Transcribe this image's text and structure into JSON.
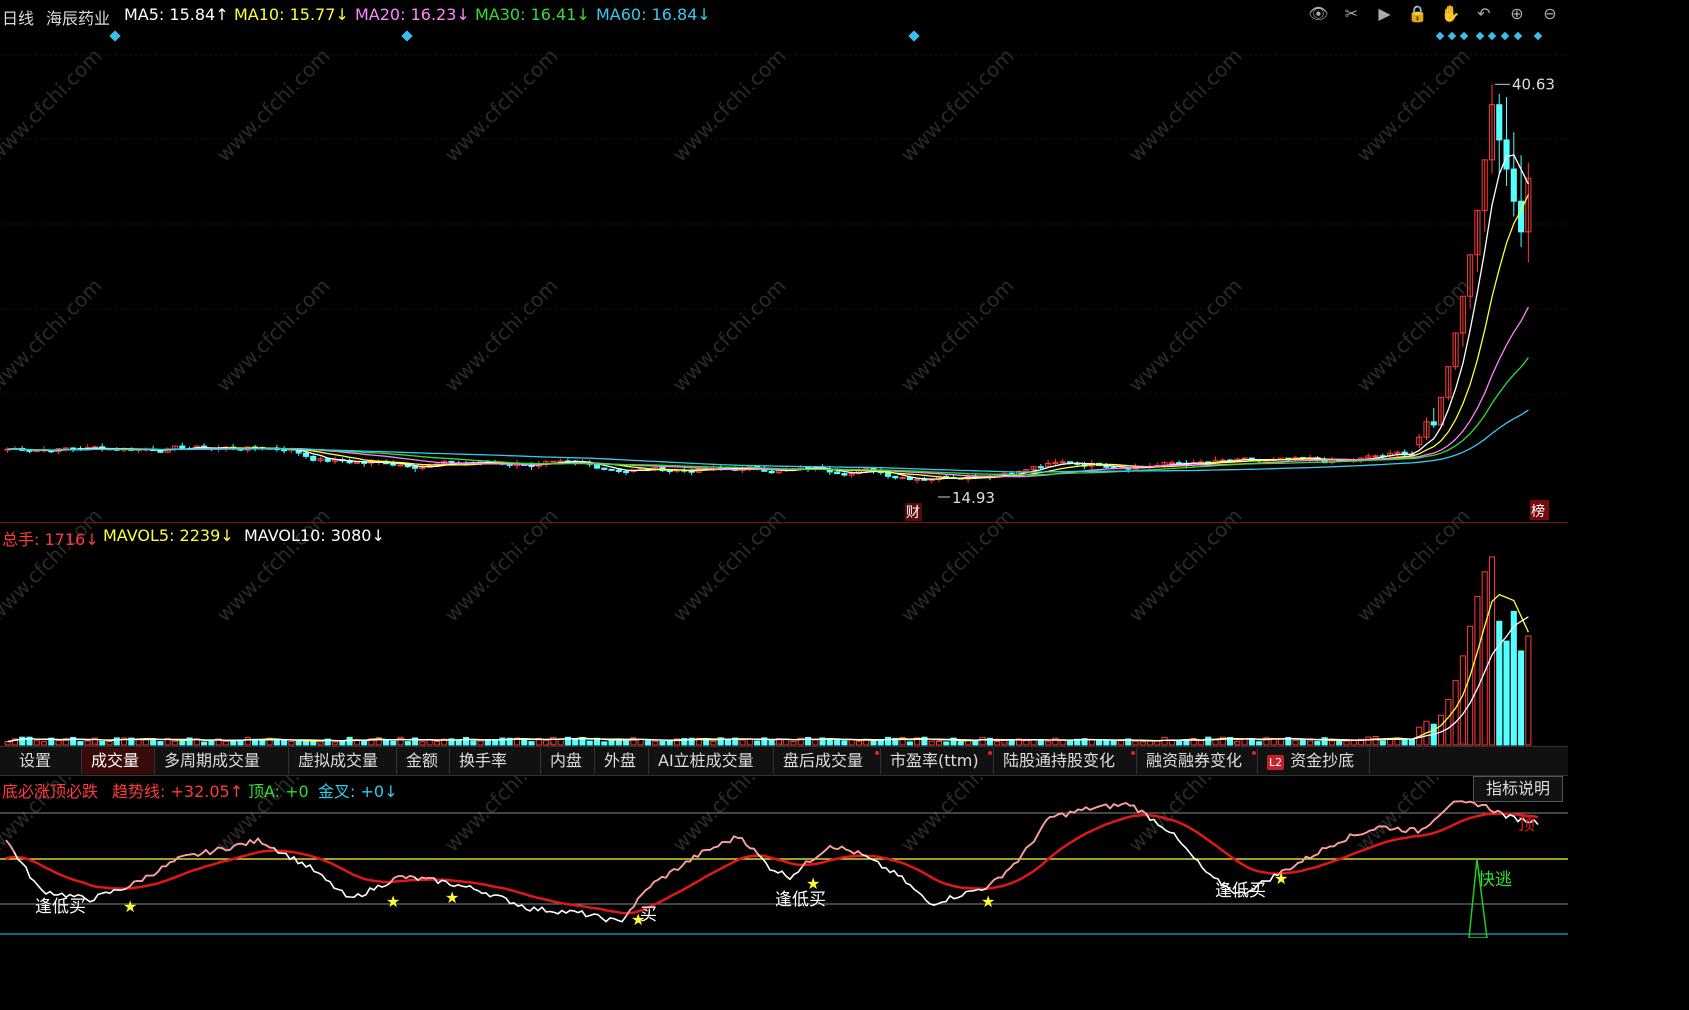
{
  "header": {
    "period": "日线",
    "stock_name": "海辰药业",
    "ma5": "MA5: 15.84↑",
    "ma10": "MA10: 15.77↓",
    "ma20": "MA20: 16.23↓",
    "ma30": "MA30: 16.41↓",
    "ma60": "MA60: 16.84↓"
  },
  "toolbar_icons": [
    "eye-icon",
    "scissors-icon",
    "play-icon",
    "lock-icon",
    "hand-icon",
    "undo-icon",
    "zoom-in-icon",
    "zoom-out-icon"
  ],
  "volume_header": {
    "total": "总手: 1716↓",
    "mavol5": "MAVOL5: 2239↓",
    "mavol10": "MAVOL10: 3080↓"
  },
  "tabs": [
    {
      "label": "设置",
      "active": false
    },
    {
      "label": "成交量",
      "active": true
    },
    {
      "label": "多周期成交量",
      "active": false
    },
    {
      "label": "虚拟成交量",
      "active": false
    },
    {
      "label": "金额",
      "active": false
    },
    {
      "label": "换手率",
      "active": false
    },
    {
      "label": "内盘",
      "active": false
    },
    {
      "label": "外盘",
      "active": false
    },
    {
      "label": "AI立桩成交量",
      "active": false
    },
    {
      "label": "盘后成交量",
      "active": false
    },
    {
      "label": "市盈率(ttm)",
      "active": false
    },
    {
      "label": "陆股通持股变化",
      "active": false
    },
    {
      "label": "融资融券变化",
      "active": false
    },
    {
      "label": "资金抄底",
      "active": false,
      "badge": "L2"
    }
  ],
  "indicator_header": {
    "name": "底必涨顶必跌",
    "trend": "趋势线: +32.05↑",
    "top": "顶A: +0",
    "golden": "金叉: +0↓"
  },
  "indicator_button": "指标说明",
  "watermark": "www.cfchi.com",
  "colors": {
    "up": "#ff3b3b",
    "down": "#54ffff",
    "ma5": "#ffffff",
    "ma10": "#ffff33",
    "ma20": "#ff80ff",
    "ma30": "#33dd33",
    "ma60": "#33ccee"
  },
  "chart_data": [
    {
      "type": "candlestick",
      "title": "海辰药业 日线",
      "annotations": [
        {
          "text": "40.63",
          "kind": "high"
        },
        {
          "text": "14.93",
          "kind": "low"
        },
        {
          "text": "财",
          "kind": "marker"
        },
        {
          "text": "榜",
          "kind": "marker"
        }
      ],
      "ylim": [
        13.5,
        43
      ],
      "series": [
        {
          "name": "MA5",
          "last": 15.84
        },
        {
          "name": "MA10",
          "last": 15.77
        },
        {
          "name": "MA20",
          "last": 16.23
        },
        {
          "name": "MA30",
          "last": 16.41
        },
        {
          "name": "MA60",
          "last": 16.84
        }
      ],
      "recent_candles_ohlc": [
        [
          17.1,
          17.8,
          16.9,
          17.6
        ],
        [
          17.6,
          18.9,
          17.4,
          18.6
        ],
        [
          18.6,
          19.5,
          18.2,
          18.4
        ],
        [
          18.4,
          20.2,
          18.3,
          20.2
        ],
        [
          20.2,
          22.2,
          20.0,
          22.2
        ],
        [
          22.2,
          24.4,
          22.0,
          24.4
        ],
        [
          24.4,
          26.8,
          23.5,
          26.8
        ],
        [
          26.8,
          29.5,
          26.0,
          29.5
        ],
        [
          29.5,
          32.4,
          28.4,
          32.4
        ],
        [
          32.4,
          35.7,
          31.0,
          35.7
        ],
        [
          35.7,
          40.63,
          34.8,
          39.3
        ],
        [
          39.3,
          40.0,
          34.8,
          37.0
        ],
        [
          37.0,
          39.8,
          34.0,
          35.1
        ],
        [
          35.1,
          37.5,
          32.0,
          33.0
        ],
        [
          33.0,
          36.0,
          30.0,
          31.0
        ],
        [
          31.0,
          35.5,
          29.0,
          34.5
        ]
      ]
    },
    {
      "type": "bar",
      "title": "成交量",
      "series": [
        {
          "name": "总手",
          "last": 1716
        },
        {
          "name": "MAVOL5",
          "last": 2239
        },
        {
          "name": "MAVOL10",
          "last": 3080
        }
      ]
    },
    {
      "type": "line",
      "title": "底必涨顶必跌",
      "series": [
        {
          "name": "趋势线",
          "last": 32.05
        }
      ],
      "labels": [
        "逢低买",
        "买",
        "逢低买",
        "逢低买",
        "快逃",
        "顶"
      ]
    }
  ]
}
